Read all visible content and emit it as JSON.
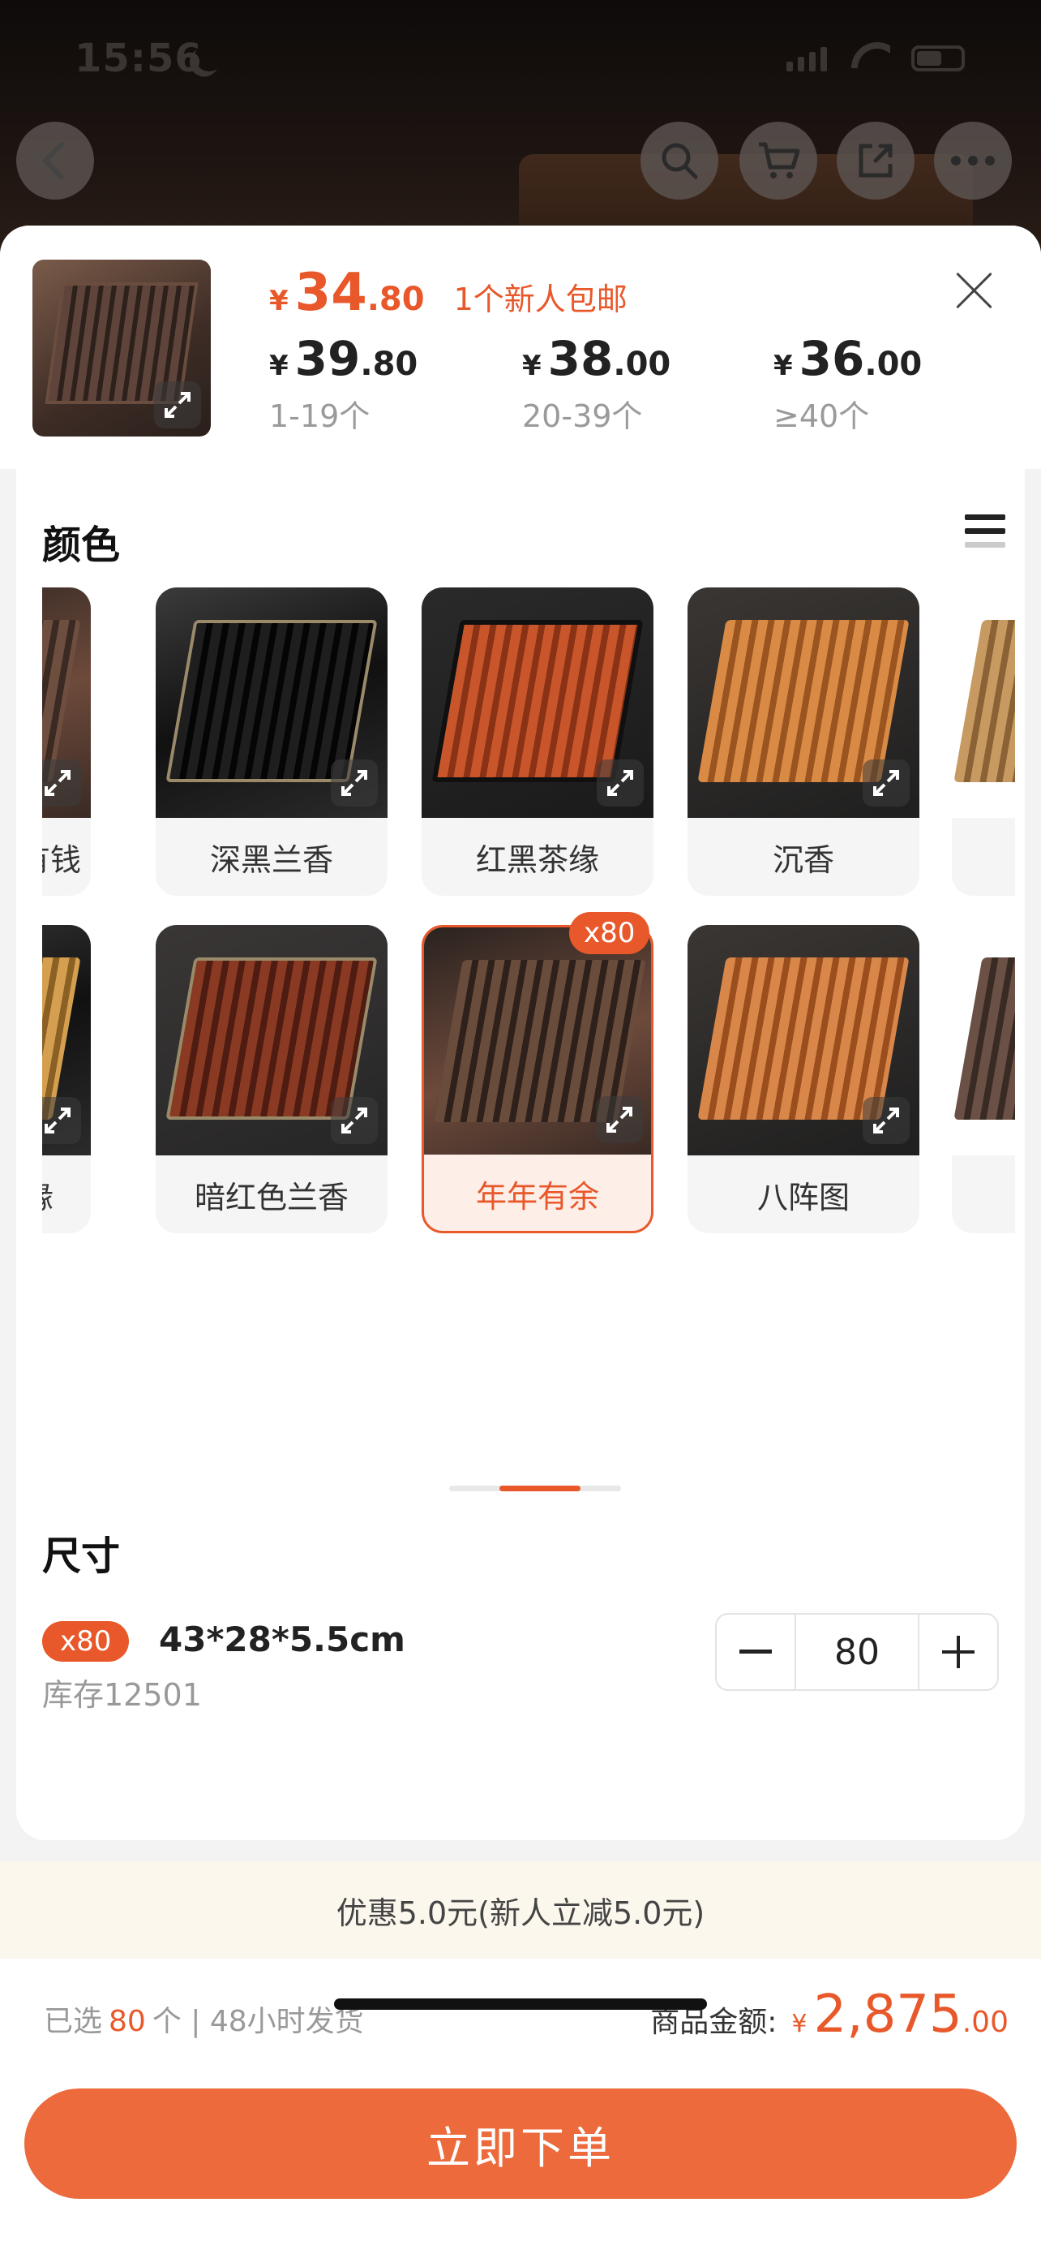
{
  "status_bar": {
    "time": "15:56"
  },
  "header": {
    "promo_price": {
      "currency": "¥",
      "integer": "34",
      "decimal": ".80"
    },
    "promo_text": "1个新人包邮",
    "tiers": [
      {
        "currency": "¥",
        "integer": "39",
        "decimal": ".80",
        "range": "1-19个"
      },
      {
        "currency": "¥",
        "integer": "38",
        "decimal": ".00",
        "range": "20-39个"
      },
      {
        "currency": "¥",
        "integer": "36",
        "decimal": ".00",
        "range": "≥40个"
      }
    ]
  },
  "color_section": {
    "title": "颜色",
    "row1": [
      "有钱",
      "深黑兰香",
      "红黑茶缘",
      "沉香"
    ],
    "row2": [
      "茶缘",
      "暗红色兰香",
      "年年有余",
      "八阵图"
    ],
    "selected_label": "年年有余",
    "selected_badge": "x80"
  },
  "size_section": {
    "title": "尺寸",
    "badge": "x80",
    "name": "43*28*5.5cm",
    "stock": "库存12501",
    "quantity": "80"
  },
  "discount": "优惠5.0元(新人立减5.0元)",
  "footer": {
    "selected_prefix": "已选",
    "selected_count": "80",
    "selected_suffix": "个 | 48小时发货",
    "total_label": "商品金额:",
    "total_currency": "¥",
    "total_integer": "2,875",
    "total_decimal": ".00",
    "order_button": "立即下单"
  },
  "colors": {
    "accent": "#e8582a",
    "button": "#ec6a3c",
    "discount_bg": "#fcf7ec"
  }
}
